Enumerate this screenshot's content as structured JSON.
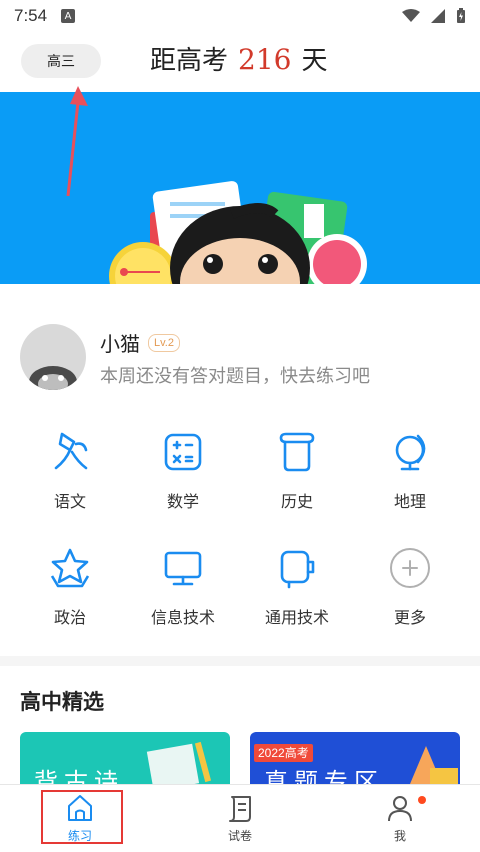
{
  "status_bar": {
    "time": "7:54",
    "notification_badge": "A"
  },
  "header": {
    "grade": "高三",
    "countdown_prefix": "距高考",
    "countdown_days": "216",
    "countdown_suffix": "天"
  },
  "profile": {
    "name": "小猫",
    "level": "Lv.2",
    "subtitle": "本周还没有答对题目，快去练习吧"
  },
  "subjects": [
    {
      "label": "语文",
      "icon": "chinese-icon"
    },
    {
      "label": "数学",
      "icon": "math-icon"
    },
    {
      "label": "历史",
      "icon": "history-icon"
    },
    {
      "label": "地理",
      "icon": "geography-icon"
    },
    {
      "label": "政治",
      "icon": "politics-icon"
    },
    {
      "label": "信息技术",
      "icon": "it-icon"
    },
    {
      "label": "通用技术",
      "icon": "general-tech-icon"
    },
    {
      "label": "更多",
      "icon": "more-icon"
    }
  ],
  "section": {
    "title": "高中精选"
  },
  "cards": [
    {
      "text": "背古诗",
      "color": "#1cc6b5"
    },
    {
      "tag": "2022高考",
      "text": "真题专区",
      "color": "#1f4fd6"
    }
  ],
  "tabs": [
    {
      "label": "练习",
      "active": true
    },
    {
      "label": "试卷",
      "active": false
    },
    {
      "label": "我",
      "active": false
    }
  ],
  "colors": {
    "accent": "#1a8cf0",
    "banner": "#0a9cf6",
    "countdown": "#d23a2b"
  }
}
